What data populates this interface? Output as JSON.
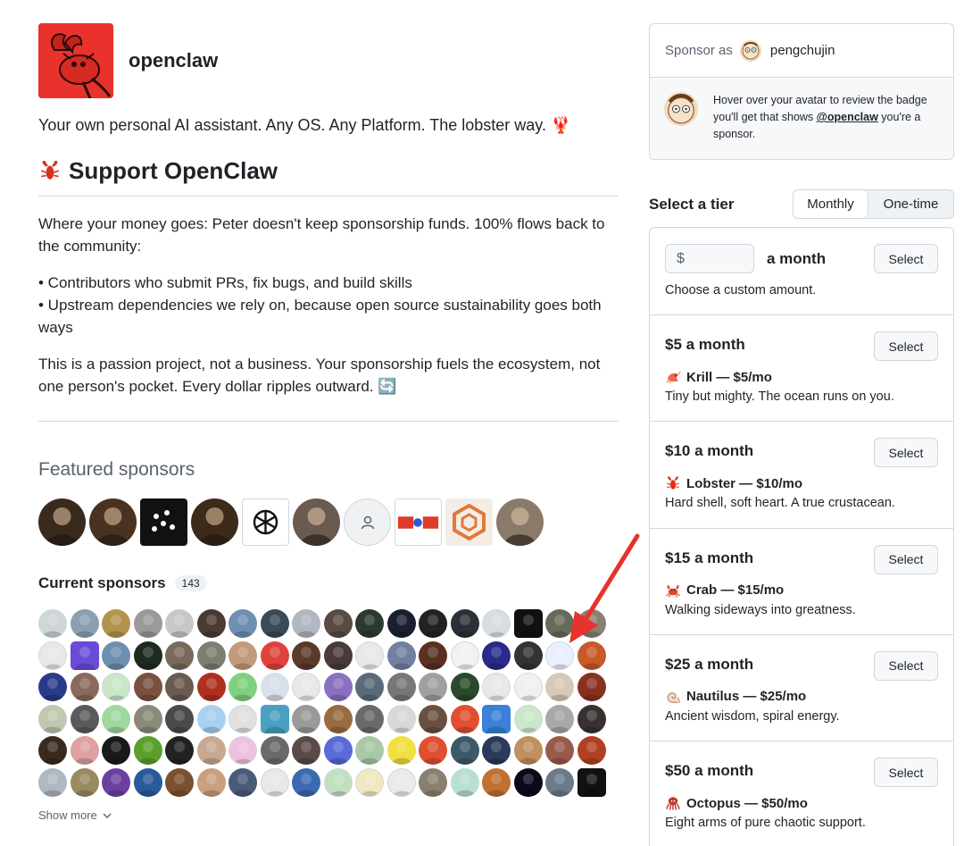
{
  "org": {
    "name": "openclaw",
    "tagline": "Your own personal AI assistant. Any OS. Any Platform. The lobster way. 🦞",
    "support_heading": "Support OpenClaw",
    "money_para": "Where your money goes: Peter doesn't keep sponsorship funds. 100% flows back to the community:",
    "bullet_1": "• Contributors who submit PRs, fix bugs, and build skills",
    "bullet_2": "• Upstream dependencies we rely on, because open source sustainability goes both ways",
    "passion_para": "This is a passion project, not a business. Your sponsorship fuels the ecosystem, not one person's pocket. Every dollar ripples outward. 🔄"
  },
  "featured": {
    "title": "Featured sponsors",
    "avatars": [
      {
        "icon": "person-avatar",
        "color": "#3a2a1e"
      },
      {
        "icon": "person-avatar",
        "color": "#4a3220"
      },
      {
        "icon": "dots-logo-avatar",
        "color": "#111111"
      },
      {
        "icon": "person-avatar",
        "color": "#3d2b1a"
      },
      {
        "icon": "openai-logo-avatar",
        "color": "#ffffff"
      },
      {
        "icon": "person-avatar",
        "color": "#6a5a50"
      },
      {
        "icon": "default-person-avatar",
        "color": "#f0f1f3"
      },
      {
        "icon": "baidu-logo-avatar",
        "color": "#ffffff"
      },
      {
        "icon": "hexagon-logo-avatar",
        "color": "#f4ede6"
      },
      {
        "icon": "person-avatar",
        "color": "#8a7a6a"
      }
    ]
  },
  "current": {
    "title": "Current sponsors",
    "count": "143",
    "show_more": "Show more",
    "avatar_colors": [
      "#cfd6d8",
      "#8aa0b0",
      "#b3944f",
      "#9a9a9a",
      "#c8c8c8",
      "#4a3a30",
      "#6f8fb3",
      "#3a4a58",
      "#b0b8c0",
      "#5a4a44",
      "#2c3a2e",
      "#1a2030",
      "#222222",
      "#2b3038",
      "#d8dde2",
      "#101010",
      "#6a6a5a",
      "#8a8070",
      "#e8e8e8",
      "#6a4bd8",
      "#6d8fb0",
      "#1f2a22",
      "#7a6a5a",
      "#7a7f70",
      "#c09a7a",
      "#e0433c",
      "#5b3a28",
      "#4a3a38",
      "#e8e8e8",
      "#7080a0",
      "#5a3020",
      "#f2f2f2",
      "#2a2a8a",
      "#333333",
      "#e8f0ff",
      "#c85a2a",
      "#2a3a8a",
      "#8a6a5a",
      "#c9e6c9",
      "#7a5040",
      "#6a5a50",
      "#b03020",
      "#7fd07f",
      "#d8e0ea",
      "#e8e8e8",
      "#8a70c0",
      "#5a6a7a",
      "#777777",
      "#a0a0a0",
      "#2a4a2a",
      "#e8e8e8",
      "#f0f0f0",
      "#d8c8b8",
      "#8a3020",
      "#c0c8b0",
      "#5a5a5a",
      "#a0d8a0",
      "#8a8a7a",
      "#4a4a4a",
      "#a8d0f0",
      "#e0e0e0",
      "#4aa0c0",
      "#9a9a9a",
      "#9a6a40",
      "#6a6a6a",
      "#d8d8d8",
      "#6a5040",
      "#e05030",
      "#3a80d8",
      "#c8e8c8",
      "#a8a8a8",
      "#3a3030",
      "#3a2a1e",
      "#e0a0a0",
      "#1a1a1a",
      "#5aa02a",
      "#222222",
      "#c8a890",
      "#f0c0e0",
      "#6a6a6a",
      "#5a4a48",
      "#5a6ad8",
      "#a8c8a8",
      "#f0e040",
      "#e05030",
      "#3a5a6a",
      "#2a3a5a",
      "#c09060",
      "#9a5a4a",
      "#b04020",
      "#b0b8c0",
      "#9a8a60",
      "#6a40a0",
      "#2a5a9a",
      "#7a5030",
      "#c8a080",
      "#4a5a7a",
      "#e8e8e8",
      "#3a6ab0",
      "#c0e0c0",
      "#f0e8c0",
      "#eaeaea",
      "#8a8070",
      "#b8e0d0",
      "#c07030",
      "#0a0a1a",
      "#6a7a8a",
      "#111111"
    ]
  },
  "sponsor_as": {
    "label": "Sponsor as",
    "username": "pengchujin",
    "hint_pre": "Hover over your avatar to review the badge you'll get that shows",
    "hint_handle": "@openclaw",
    "hint_post": "you're a sponsor."
  },
  "tiers_section": {
    "title": "Select a tier",
    "monthly": "Monthly",
    "one_time": "One-time",
    "custom": {
      "currency": "$",
      "suffix": "a month",
      "desc": "Choose a custom amount.",
      "button": "Select"
    },
    "tiers": [
      {
        "price": "$5 a month",
        "name": "Krill — $5/mo",
        "desc": "Tiny but mighty. The ocean runs on you.",
        "icon": "krill-icon",
        "button": "Select"
      },
      {
        "price": "$10 a month",
        "name": "Lobster — $10/mo",
        "desc": "Hard shell, soft heart. A true crustacean.",
        "icon": "lobster-icon",
        "button": "Select"
      },
      {
        "price": "$15 a month",
        "name": "Crab — $15/mo",
        "desc": "Walking sideways into greatness.",
        "icon": "crab-icon",
        "button": "Select"
      },
      {
        "price": "$25 a month",
        "name": "Nautilus — $25/mo",
        "desc": "Ancient wisdom, spiral energy.",
        "icon": "nautilus-icon",
        "button": "Select"
      },
      {
        "price": "$50 a month",
        "name": "Octopus — $50/mo",
        "desc": "Eight arms of pure chaotic support.",
        "icon": "octopus-icon",
        "button": "Select"
      }
    ]
  },
  "colors": {
    "accent_red": "#e8322b",
    "border": "#d0d7de",
    "muted": "#59636e"
  }
}
